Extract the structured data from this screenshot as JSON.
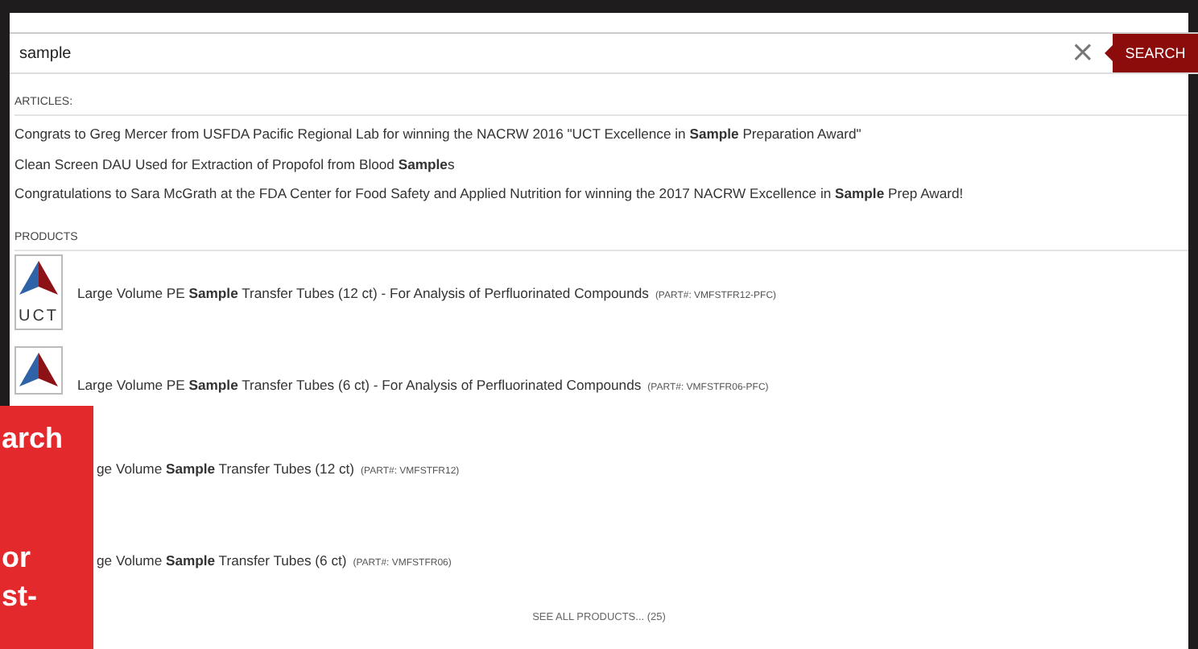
{
  "search": {
    "value": "sample",
    "clear_label": "×",
    "button": "SEARCH"
  },
  "articles": {
    "heading": "ARTICLES:",
    "items": [
      {
        "title": "Congrats to Greg Mercer from USFDA Pacific Regional Lab for winning the NACRW 2016 \"UCT Excellence in **Sample** Preparation Award\""
      },
      {
        "title": "Clean Screen DAU Used for Extraction of Propofol from Blood **Sample**s"
      },
      {
        "title": "Congratulations to Sara McGrath at the FDA Center for Food Safety and Applied Nutrition for winning the 2017 NACRW Excellence in **Sample** Prep Award!"
      }
    ]
  },
  "products": {
    "heading": "PRODUCTS",
    "items": [
      {
        "logo": true,
        "logo_text": "UCT",
        "name": "Large Volume PE **Sample** Transfer Tubes (12 ct) - For Analysis of Perfluorinated Compounds",
        "part": "(PART#: VMFSTFR12-PFC)"
      },
      {
        "logo": true,
        "name": "Large Volume PE **Sample** Transfer Tubes (6 ct) - For Analysis of Perfluorinated Compounds",
        "part": "(PART#: VMFSTFR06-PFC)"
      },
      {
        "logo": false,
        "name": "ge Volume **Sample** Transfer Tubes (12 ct)",
        "part": "(PART#: VMFSTFR12)"
      },
      {
        "logo": false,
        "name": "ge Volume **Sample** Transfer Tubes (6 ct)",
        "part": "(PART#: VMFSTFR06)"
      }
    ],
    "see_all": "SEE ALL PRODUCTS... (25)"
  },
  "overlay": {
    "lines": [
      "arch",
      "or",
      "st-"
    ]
  }
}
